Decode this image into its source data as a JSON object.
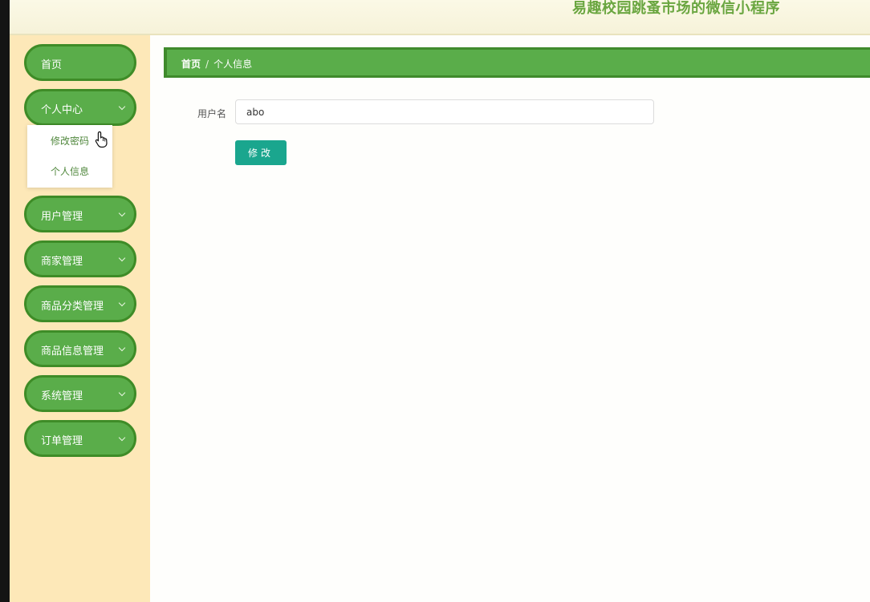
{
  "header": {
    "title": "易趣校园跳蚤市场的微信小程序"
  },
  "sidebar": {
    "items": [
      {
        "label": "首页"
      },
      {
        "label": "个人中心"
      },
      {
        "label": "用户管理"
      },
      {
        "label": "商家管理"
      },
      {
        "label": "商品分类管理"
      },
      {
        "label": "商品信息管理"
      },
      {
        "label": "系统管理"
      },
      {
        "label": "订单管理"
      }
    ],
    "submenu": [
      {
        "label": "修改密码"
      },
      {
        "label": "个人信息"
      }
    ]
  },
  "breadcrumb": {
    "home": "首页",
    "separator": "/",
    "current": "个人信息"
  },
  "form": {
    "username_label": "用户名",
    "username_value": "abo",
    "submit_label": "修改"
  },
  "colors": {
    "primary_green": "#5aad4a",
    "dark_green_border": "#3e8c27",
    "sidebar_bg": "#fde8b8",
    "button_teal": "#1aa68e",
    "title_green": "#6aa640"
  },
  "icons": {
    "chevron": "chevron-down-icon",
    "cursor": "hand-pointer-cursor"
  }
}
